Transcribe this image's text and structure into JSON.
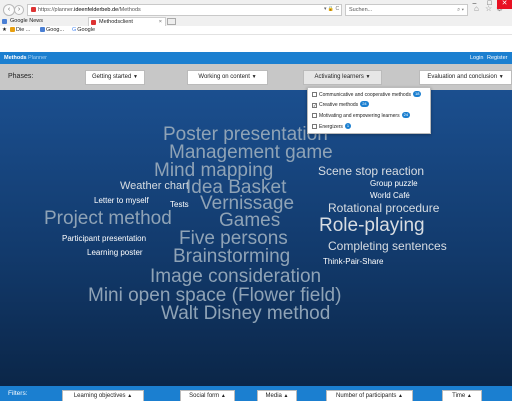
{
  "browser": {
    "url_prefix": "https://planner.",
    "url_host": "ideenfelderbeb.de",
    "url_path": "/Methods",
    "search_placeholder": "Suchen...",
    "tabs": [
      {
        "label": "Google News"
      },
      {
        "label": "Methodsclient"
      }
    ],
    "bookmarks": [
      {
        "label": "Die ..."
      },
      {
        "label": "Goog..."
      },
      {
        "label": "Google"
      }
    ]
  },
  "app": {
    "nav_methods": "Methods",
    "nav_planner": "Planner",
    "login": "Login",
    "register": "Register"
  },
  "phases": {
    "label": "Phases:",
    "items": [
      {
        "label": "Getting started"
      },
      {
        "label": "Working on content"
      },
      {
        "label": "Activating learners"
      },
      {
        "label": "Evaluation and conclusion"
      }
    ]
  },
  "dropdown": {
    "items": [
      {
        "label": "Communicative and cooperative methods",
        "count": "18",
        "checked": false
      },
      {
        "label": "Creative methods",
        "count": "24",
        "checked": true
      },
      {
        "label": "Motivating and empowering learners",
        "count": "24",
        "checked": false
      },
      {
        "label": "Energizers",
        "count": "1",
        "checked": false
      }
    ]
  },
  "cloud": [
    {
      "text": "Poster presentation",
      "color": "#8fa3b6"
    },
    {
      "text": "Management game",
      "color": "#8fa3b6"
    },
    {
      "text": "Mind mapping",
      "color": "#8fa3b6"
    },
    {
      "text": "Scene stop reaction",
      "color": "#d8dde2"
    },
    {
      "text": "Weather chart",
      "color": "#d8dde2"
    },
    {
      "text": "Idea Basket",
      "color": "#8fa3b6"
    },
    {
      "text": "Group puzzle",
      "color": "#ffffff"
    },
    {
      "text": "Letter to myself",
      "color": "#ffffff"
    },
    {
      "text": "World Café",
      "color": "#ffffff"
    },
    {
      "text": "Tests",
      "color": "#ffffff"
    },
    {
      "text": "Vernissage",
      "color": "#8fa3b6"
    },
    {
      "text": "Rotational procedure",
      "color": "#d8dde2"
    },
    {
      "text": "Project method",
      "color": "#8fa3b6"
    },
    {
      "text": "Games",
      "color": "#8fa3b6"
    },
    {
      "text": "Role-playing",
      "color": "#d8dde2"
    },
    {
      "text": "Five persons",
      "color": "#8fa3b6"
    },
    {
      "text": "Participant presentation",
      "color": "#ffffff"
    },
    {
      "text": "Completing sentences",
      "color": "#d8dde2"
    },
    {
      "text": "Learning poster",
      "color": "#ffffff"
    },
    {
      "text": "Brainstorming",
      "color": "#8fa3b6"
    },
    {
      "text": "Think-Pair-Share",
      "color": "#ffffff"
    },
    {
      "text": "Image consideration",
      "color": "#8fa3b6"
    },
    {
      "text": "Mini open space (Flower field)",
      "color": "#8fa3b6"
    },
    {
      "text": "Walt Disney method",
      "color": "#8fa3b6"
    }
  ],
  "filters": {
    "label": "Filters:",
    "items": [
      {
        "label": "Learning objectives"
      },
      {
        "label": "Social form"
      },
      {
        "label": "Media"
      },
      {
        "label": "Number of participants"
      },
      {
        "label": "Time"
      }
    ]
  },
  "colors": {
    "brand": "#1b7fd0",
    "phases_bar": "#c7c7c7",
    "cloud_background": "#123a6c"
  }
}
